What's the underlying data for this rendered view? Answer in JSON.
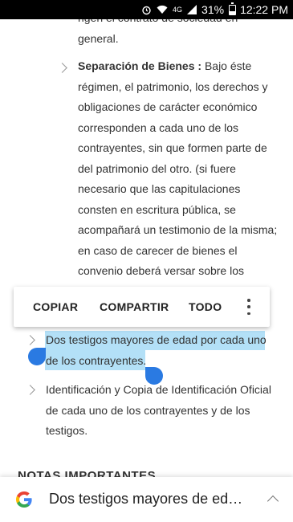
{
  "status_bar": {
    "signal": "4G",
    "battery": "31%",
    "time": "12:22 PM"
  },
  "article": {
    "top_fragment_1": "rigen el contrato de sociedad en",
    "top_fragment_2": "general.",
    "separacion_title": "Separación de Bienes :",
    "separacion_lines": [
      " Bajo éste",
      "régimen, el patrimonio, los derechos y",
      "obligaciones de carácter económico",
      "corresponden a cada uno de los",
      "contrayentes, sin que formen parte de",
      "del patrimonio del otro. (si fuere",
      "necesario que las capitulaciones",
      "consten en escritura pública, se",
      "acompañará un testimonio de la misma;",
      "en caso de carecer de bienes el",
      "convenio deberá versar sobre los"
    ],
    "testigos_line_1": "Dos testigos mayores de edad por cada uno",
    "testigos_line_2": "de los contrayentes.",
    "identificacion_lines": [
      "Identificación y Copia de Identificación Oficial",
      "de cada uno de los contrayentes y de los",
      "testigos."
    ],
    "next_heading": "NOTAS IMPORTANTES"
  },
  "context_menu": {
    "copy": "COPIAR",
    "share": "COMPARTIR",
    "select_all": "TODO",
    "more_icon": "more-vertical-icon"
  },
  "google_bar": {
    "logo_icon": "google-g-icon",
    "query": "Dos testigos mayores de ed…",
    "expand_icon": "chevron-up-icon"
  },
  "colors": {
    "selection": "#b3e0f7",
    "handle": "#2a7ae2"
  }
}
